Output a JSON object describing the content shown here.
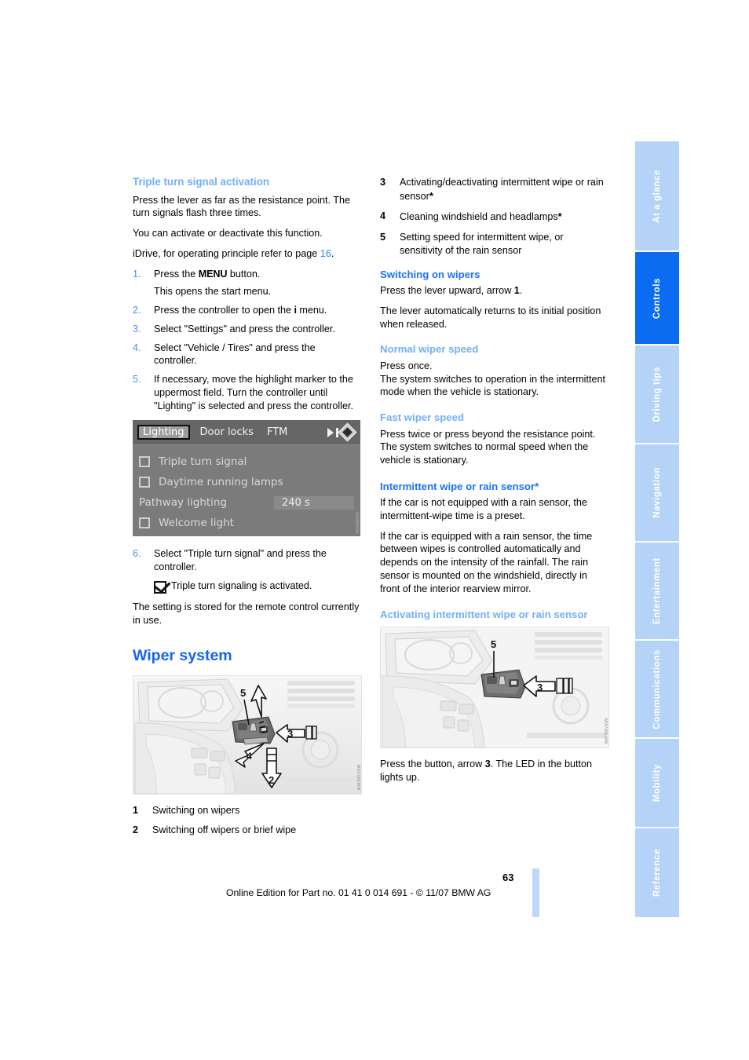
{
  "document": {
    "page_number": "63",
    "footer_note": "Online Edition for Part no. 01 41 0 014 691 - © 11/07 BMW AG"
  },
  "sidebar": {
    "tabs": [
      {
        "label": "At a glance",
        "active": false
      },
      {
        "label": "Controls",
        "active": true
      },
      {
        "label": "Driving tips",
        "active": false
      },
      {
        "label": "Navigation",
        "active": false
      },
      {
        "label": "Entertainment",
        "active": false
      },
      {
        "label": "Communications",
        "active": false
      },
      {
        "label": "Mobility",
        "active": false
      },
      {
        "label": "Reference",
        "active": false
      }
    ],
    "colors": {
      "active_bg": "#0a6cf0",
      "inactive_bg": "#b4d3f7",
      "label": "#ffffff"
    }
  },
  "colors": {
    "heading_strong": "#1565f0",
    "heading_sub": "#1b72f2",
    "heading_light": "#72b0f5",
    "list_number": "#4a90e8",
    "page_link": "#2d86f0"
  },
  "left_column": {
    "section_heading": "Triple turn signal activation",
    "intro_1": "Press the lever as far as the resistance point. The turn signals flash three times.",
    "intro_2": "You can activate or deactivate this function.",
    "idrive_ref_prefix": "iDrive, for operating principle refer to page ",
    "idrive_ref_page": "16",
    "idrive_ref_suffix": ".",
    "steps": [
      {
        "num": "1.",
        "text_before": "Press the ",
        "key": "MENU",
        "text_after": " button.",
        "sub": "This opens the start menu."
      },
      {
        "num": "2.",
        "text_before": "Press the controller to open the ",
        "key": "i",
        "text_after": " menu.",
        "sub": ""
      },
      {
        "num": "3.",
        "text": "Select \"Settings\" and press the controller."
      },
      {
        "num": "4.",
        "text": "Select \"Vehicle / Tires\" and press the controller."
      },
      {
        "num": "5.",
        "text": "If necessary, move the highlight marker to the uppermost field. Turn the controller until \"Lighting\" is selected and press the controller."
      }
    ],
    "idrive_screen": {
      "tabs": [
        "Lighting",
        "Door locks",
        "FTM"
      ],
      "selected_tab": "Lighting",
      "icons": [
        "play-icon",
        "bar-icon",
        "diamond-icon"
      ],
      "rows": [
        {
          "checkbox": true,
          "label": "Triple turn signal",
          "value": ""
        },
        {
          "checkbox": true,
          "label": "Daytime running lamps",
          "value": ""
        },
        {
          "checkbox": false,
          "label": "Pathway lighting",
          "value": "240 s"
        },
        {
          "checkbox": true,
          "label": "Welcome light",
          "value": ""
        }
      ],
      "image_code": "ZAZB0303A"
    },
    "step_6": {
      "num": "6.",
      "text": "Select \"Triple turn signal\" and press the controller."
    },
    "confirmation": "Triple turn signaling is activated.",
    "closing": "The setting is stored for the remote control currently in use.",
    "wiper_heading": "Wiper system",
    "wiper_image_code": "MOV.000.MW",
    "legend": [
      {
        "num": "1",
        "text": "Switching on wipers"
      },
      {
        "num": "2",
        "text": "Switching off wipers or brief wipe"
      }
    ]
  },
  "right_column": {
    "legend_continued": [
      {
        "num": "3",
        "text": "Activating/deactivating intermittent wipe or rain sensor",
        "star": "*"
      },
      {
        "num": "4",
        "text": "Cleaning windshield and headlamps",
        "star": "*"
      },
      {
        "num": "5",
        "text": "Setting speed for intermittent wipe, or sensitivity of the rain sensor",
        "star": ""
      }
    ],
    "switching_on": {
      "heading": "Switching on wipers",
      "para_1_before": "Press the lever upward, arrow ",
      "para_1_arrow": "1",
      "para_1_after": ".",
      "para_2": "The lever automatically returns to its initial position when released."
    },
    "normal_speed": {
      "heading": "Normal wiper speed",
      "line_1": "Press once.",
      "line_2": "The system switches to operation in the intermittent mode when the vehicle is stationary."
    },
    "fast_speed": {
      "heading": "Fast wiper speed",
      "line_1": "Press twice or press beyond the resistance point.",
      "line_2": "The system switches to normal speed when the vehicle is stationary."
    },
    "intermittent": {
      "heading": "Intermittent wipe or rain sensor*",
      "para_1": "If the car is not equipped with a rain sensor, the intermittent-wipe time is a preset.",
      "para_2": "If the car is equipped with a rain sensor, the time between wipes is controlled automatically and depends on the intensity of the rainfall. The rain sensor is mounted on the windshield, directly in front of the interior rearview mirror."
    },
    "activating": {
      "heading": "Activating intermittent wipe or rain sensor",
      "image_code": "MOV.000.MW",
      "caption_before": "Press the button, arrow ",
      "caption_arrow": "3",
      "caption_after": ". The LED in the button lights up."
    }
  }
}
